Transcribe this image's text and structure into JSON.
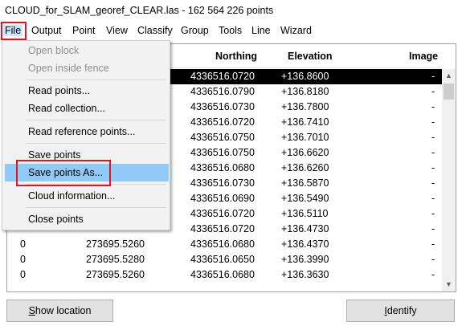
{
  "window": {
    "title": "CLOUD_for_SLAM_georef_CLEAR.las - 162 564 226 points"
  },
  "menubar": {
    "items": [
      "File",
      "Output",
      "Point",
      "View",
      "Classify",
      "Group",
      "Tools",
      "Line",
      "Wizard"
    ]
  },
  "file_menu": {
    "items": [
      {
        "label": "Open block",
        "disabled": true
      },
      {
        "label": "Open inside fence",
        "disabled": true
      },
      {
        "label": "Read points...",
        "disabled": false
      },
      {
        "label": "Read collection...",
        "disabled": false
      },
      {
        "label": "Read reference points...",
        "disabled": false
      },
      {
        "label": "Save points",
        "disabled": false
      },
      {
        "label": "Save points As...",
        "disabled": false,
        "highlighted": true
      },
      {
        "label": "Cloud information...",
        "disabled": false
      },
      {
        "label": "Close points",
        "disabled": false
      }
    ]
  },
  "table": {
    "headers": {
      "northing": "Northing",
      "elevation": "Elevation",
      "image": "Image"
    },
    "rows": [
      {
        "c0": "",
        "easting": "",
        "northing": "4336516.0720",
        "elevation": "+136.8600",
        "image": "-",
        "selected": true
      },
      {
        "c0": "",
        "easting": "",
        "northing": "4336516.0790",
        "elevation": "+136.8180",
        "image": "-"
      },
      {
        "c0": "",
        "easting": "",
        "northing": "4336516.0730",
        "elevation": "+136.7800",
        "image": "-"
      },
      {
        "c0": "",
        "easting": "",
        "northing": "4336516.0720",
        "elevation": "+136.7410",
        "image": "-"
      },
      {
        "c0": "",
        "easting": "",
        "northing": "4336516.0750",
        "elevation": "+136.7010",
        "image": "-"
      },
      {
        "c0": "",
        "easting": "",
        "northing": "4336516.0750",
        "elevation": "+136.6620",
        "image": "-"
      },
      {
        "c0": "",
        "easting": "",
        "northing": "4336516.0680",
        "elevation": "+136.6260",
        "image": "-"
      },
      {
        "c0": "",
        "easting": "",
        "northing": "4336516.0730",
        "elevation": "+136.5870",
        "image": "-"
      },
      {
        "c0": "",
        "easting": "",
        "northing": "4336516.0690",
        "elevation": "+136.5490",
        "image": "-"
      },
      {
        "c0": "",
        "easting": "",
        "northing": "4336516.0720",
        "elevation": "+136.5110",
        "image": "-"
      },
      {
        "c0": "",
        "easting": "",
        "northing": "4336516.0720",
        "elevation": "+136.4730",
        "image": "-"
      },
      {
        "c0": "0",
        "easting": "273695.5260",
        "northing": "4336516.0680",
        "elevation": "+136.4370",
        "image": "-"
      },
      {
        "c0": "0",
        "easting": "273695.5280",
        "northing": "4336516.0650",
        "elevation": "+136.3990",
        "image": "-"
      },
      {
        "c0": "0",
        "easting": "273695.5260",
        "northing": "4336516.0680",
        "elevation": "+136.3630",
        "image": "-"
      }
    ]
  },
  "buttons": {
    "show_location_first": "S",
    "show_location_rest": "how location",
    "identify_first": "I",
    "identify_rest": "dentify"
  },
  "colors": {
    "highlight": "#91c9f7",
    "annotation_red": "#e0152a",
    "selection": "#000000"
  }
}
